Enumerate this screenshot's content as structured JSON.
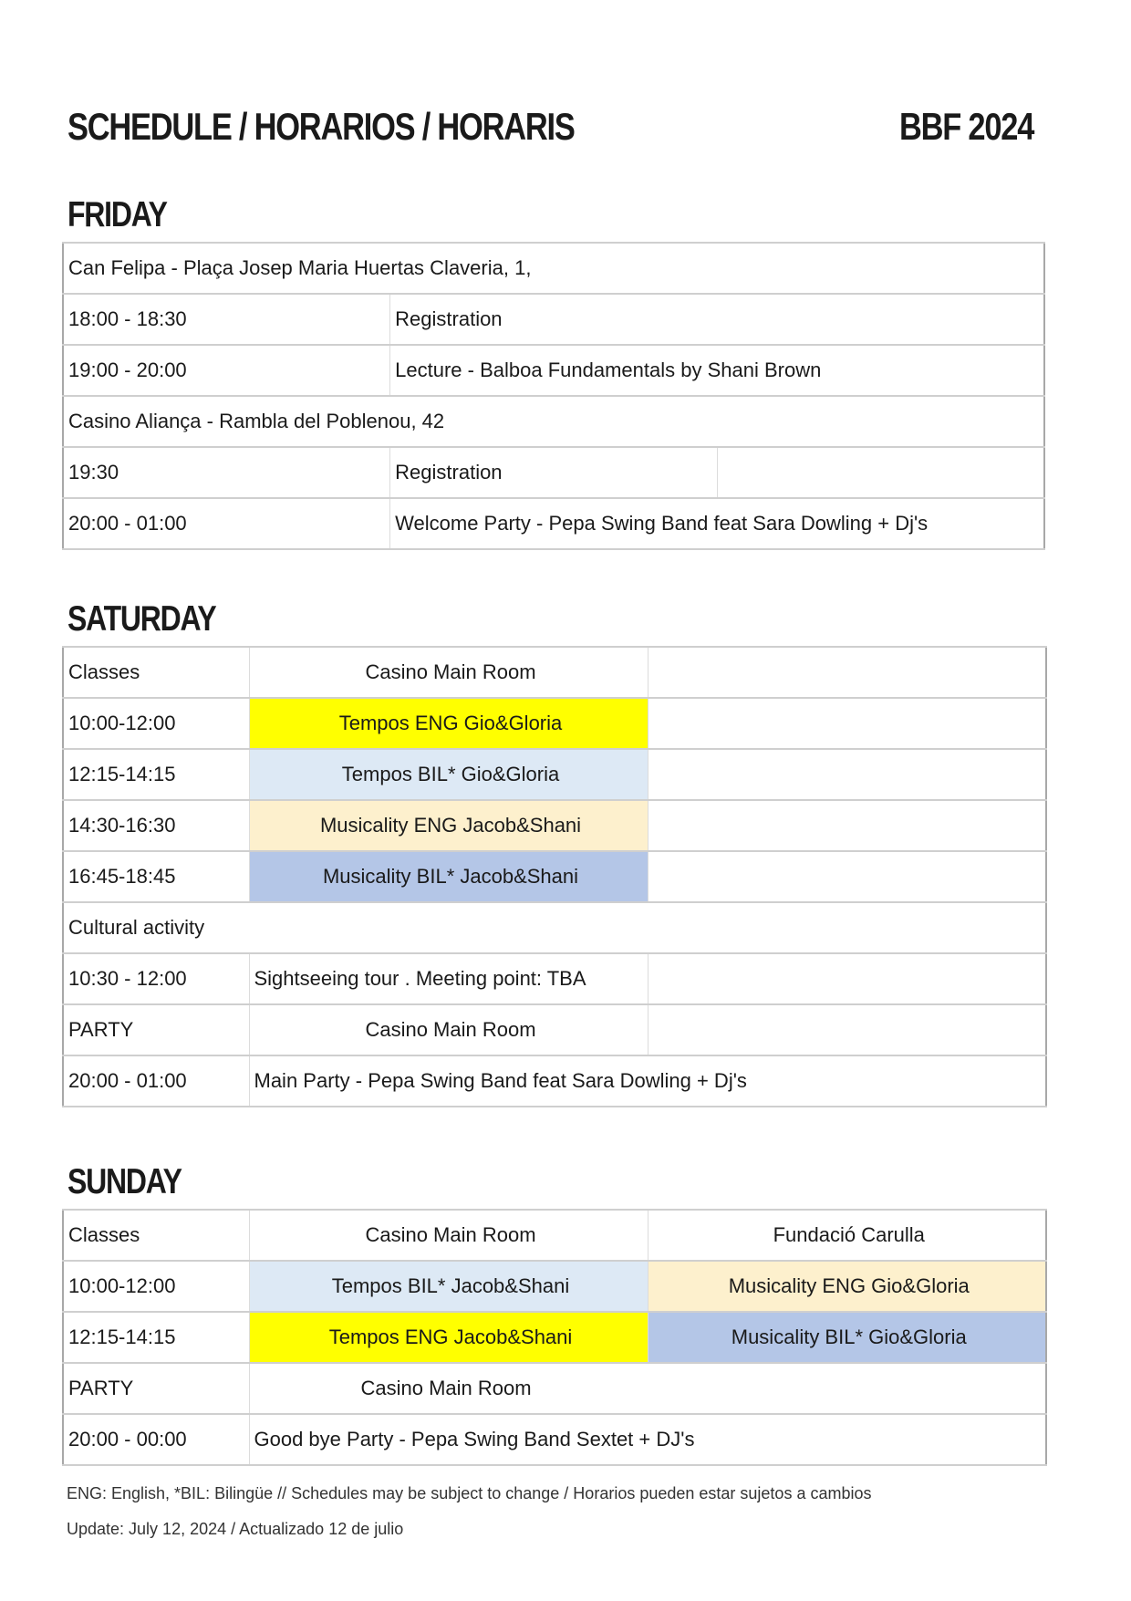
{
  "header": {
    "title": "SCHEDULE / HORARIOS / HORARIS",
    "event": "BBF 2024"
  },
  "friday": {
    "title": "FRIDAY",
    "venue1": "Can Felipa - Plaça Josep Maria Huertas Claveria, 1,",
    "rows1": [
      {
        "time": "18:00 - 18:30",
        "activity": "Registration"
      },
      {
        "time": "19:00 - 20:00",
        "activity": "Lecture - Balboa Fundamentals by Shani Brown"
      }
    ],
    "venue2": "Casino Aliança - Rambla del Poblenou, 42",
    "rows2": [
      {
        "time": "19:30",
        "activity": "Registration"
      },
      {
        "time": "20:00 - 01:00",
        "activity": "Welcome Party - Pepa Swing Band feat Sara Dowling + Dj's"
      }
    ]
  },
  "saturday": {
    "title": "SATURDAY",
    "classes_label": "Classes",
    "room": "Casino Main Room",
    "classes": [
      {
        "time": "10:00-12:00",
        "class": "Tempos ENG Gio&Gloria",
        "color": "#ffff00"
      },
      {
        "time": "12:15-14:15",
        "class": "Tempos BIL* Gio&Gloria",
        "color": "#dde9f5"
      },
      {
        "time": "14:30-16:30",
        "class": "Musicality ENG Jacob&Shani",
        "color": "#fdf0cd"
      },
      {
        "time": "16:45-18:45",
        "class": "Musicality BIL* Jacob&Shani",
        "color": "#b4c6e7"
      }
    ],
    "cultural_label": "Cultural activity",
    "cultural": {
      "time": "10:30  - 12:00",
      "activity": "Sightseeing tour . Meeting point: TBA"
    },
    "party_label": "PARTY",
    "party_room": "Casino Main Room",
    "party": {
      "time": "20:00 - 01:00",
      "activity": "Main Party - Pepa Swing Band feat Sara Dowling + Dj's"
    }
  },
  "sunday": {
    "title": "SUNDAY",
    "classes_label": "Classes",
    "room1": "Casino Main Room",
    "room2": "Fundació Carulla",
    "classes": [
      {
        "time": "10:00-12:00",
        "room1_class": "Tempos BIL* Jacob&Shani",
        "room2_class": "Musicality ENG Gio&Gloria"
      },
      {
        "time": "12:15-14:15",
        "room1_class": "Tempos ENG Jacob&Shani",
        "room2_class": "Musicality BIL* Gio&Gloria"
      }
    ],
    "party_label": "PARTY",
    "party_room": "Casino Main Room",
    "party": {
      "time": "20:00 - 00:00",
      "activity": "Good bye Party - Pepa Swing Band Sextet + DJ's"
    }
  },
  "footer": {
    "legend": "ENG: English, *BIL: Bilingüe //  Schedules may be subject to change / Horarios pueden estar sujetos a cambios",
    "update": "Update: July 12, 2024 / Actualizado 12 de julio"
  },
  "colors": {
    "yellow": "#ffff00",
    "light_blue": "#dde9f5",
    "cream": "#fdf0cd",
    "medium_blue": "#b4c6e7"
  }
}
